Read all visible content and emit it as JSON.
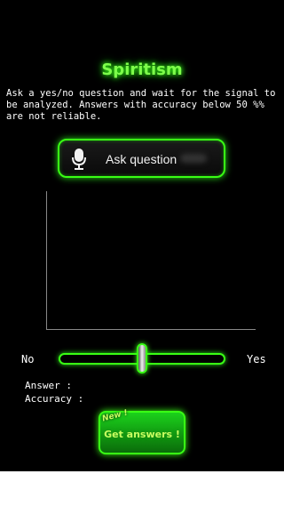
{
  "app": {
    "title": "Spiritism",
    "description": "Ask a yes/no question and wait for the signal to be analyzed. Answers with accuracy below 50 %% are not reliable."
  },
  "ask_button": {
    "label": "Ask question",
    "icon": "microphone-icon"
  },
  "slider": {
    "left_label": "No",
    "right_label": "Yes",
    "value": 0.5
  },
  "results": {
    "answer_label": "Answer :",
    "accuracy_label": "Accuracy :"
  },
  "get_answers_button": {
    "label": "Get answers !",
    "badge": "New !"
  },
  "colors": {
    "background": "#000000",
    "accent": "#39ff14",
    "text": "#ffffff"
  }
}
